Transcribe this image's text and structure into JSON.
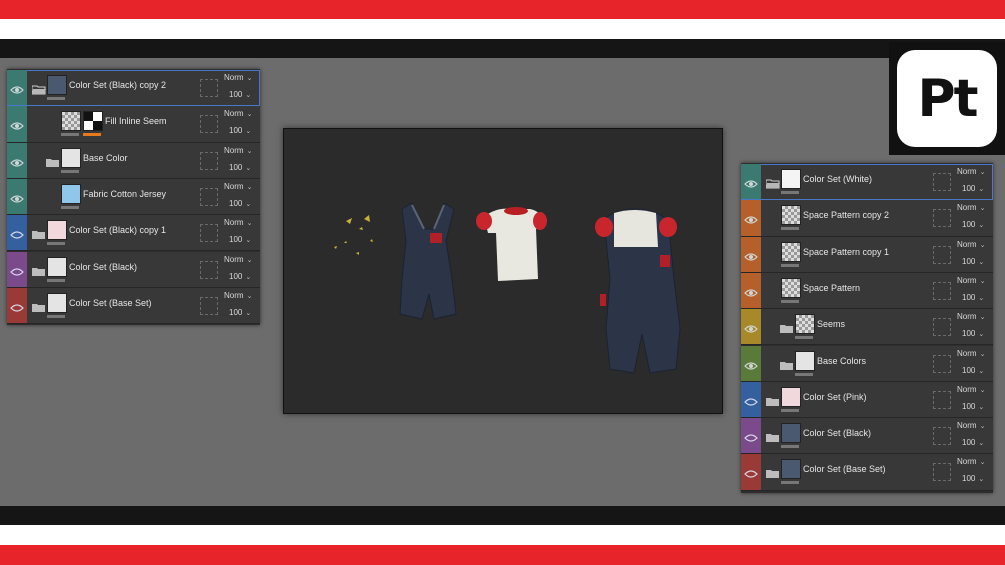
{
  "app": {
    "logo_text": "Pt",
    "colors": {
      "frame_red": "#e8242b",
      "frame_black": "#151515",
      "selection_blue": "#4a78c8"
    }
  },
  "left_panel": {
    "layers": [
      {
        "name": "Color Set (Black) copy 2",
        "blend": "Norm",
        "opacity": "100",
        "strip_color": "#3a7a70",
        "eye": "open",
        "folder": "open",
        "thumb": "dark",
        "selected": true
      },
      {
        "name": "Fill Inline Seem",
        "blend": "Norm",
        "opacity": "100",
        "strip_color": "#3a7a70",
        "eye": "open",
        "folder": "none",
        "thumb": "checker",
        "mask_thumb": true,
        "indent": 1
      },
      {
        "name": "Base Color",
        "blend": "Norm",
        "opacity": "100",
        "strip_color": "#3a7a70",
        "eye": "open",
        "folder": "closed",
        "thumb": "light",
        "indent": 1
      },
      {
        "name": "Fabric Cotton Jersey",
        "blend": "Norm",
        "opacity": "100",
        "strip_color": "#3a7a70",
        "eye": "open",
        "folder": "none",
        "thumb": "blue",
        "indent": 1
      },
      {
        "name": "Color Set (Black) copy 1",
        "blend": "Norm",
        "opacity": "100",
        "strip_color": "#3560a0",
        "eye": "closed",
        "folder": "closed",
        "thumb": "pink"
      },
      {
        "name": "Color Set (Black)",
        "blend": "Norm",
        "opacity": "100",
        "strip_color": "#7a4a8a",
        "eye": "closed",
        "folder": "closed",
        "thumb": "light"
      },
      {
        "name": "Color Set (Base Set)",
        "blend": "Norm",
        "opacity": "100",
        "strip_color": "#9a3a36",
        "eye": "closed",
        "folder": "closed",
        "thumb": "light"
      }
    ]
  },
  "right_panel": {
    "layers": [
      {
        "name": "Color Set (White)",
        "blend": "Norm",
        "opacity": "100",
        "strip_color": "#3a7a70",
        "eye": "open",
        "folder": "open",
        "thumb": "white",
        "selected": true
      },
      {
        "name": "Space Pattern copy 2",
        "blend": "Norm",
        "opacity": "100",
        "strip_color": "#b5602a",
        "eye": "open",
        "folder": "none",
        "thumb": "checker"
      },
      {
        "name": "Space Pattern copy 1",
        "blend": "Norm",
        "opacity": "100",
        "strip_color": "#b5602a",
        "eye": "open",
        "folder": "none",
        "thumb": "checker"
      },
      {
        "name": "Space Pattern",
        "blend": "Norm",
        "opacity": "100",
        "strip_color": "#b5602a",
        "eye": "open",
        "folder": "none",
        "thumb": "checker"
      },
      {
        "name": "Seems",
        "blend": "Norm",
        "opacity": "100",
        "strip_color": "#a8892a",
        "eye": "open",
        "folder": "closed",
        "thumb": "checker",
        "indent": 1
      },
      {
        "name": "Base Colors",
        "blend": "Norm",
        "opacity": "100",
        "strip_color": "#5a7a3a",
        "eye": "open",
        "folder": "closed",
        "thumb": "light",
        "indent": 1
      },
      {
        "name": "Color Set (Pink)",
        "blend": "Norm",
        "opacity": "100",
        "strip_color": "#3560a0",
        "eye": "closed",
        "folder": "closed",
        "thumb": "pink"
      },
      {
        "name": "Color Set (Black)",
        "blend": "Norm",
        "opacity": "100",
        "strip_color": "#7a4a8a",
        "eye": "closed",
        "folder": "closed",
        "thumb": "dark"
      },
      {
        "name": "Color Set (Base Set)",
        "blend": "Norm",
        "opacity": "100",
        "strip_color": "#9a3a36",
        "eye": "closed",
        "folder": "closed",
        "thumb": "dark"
      }
    ]
  }
}
